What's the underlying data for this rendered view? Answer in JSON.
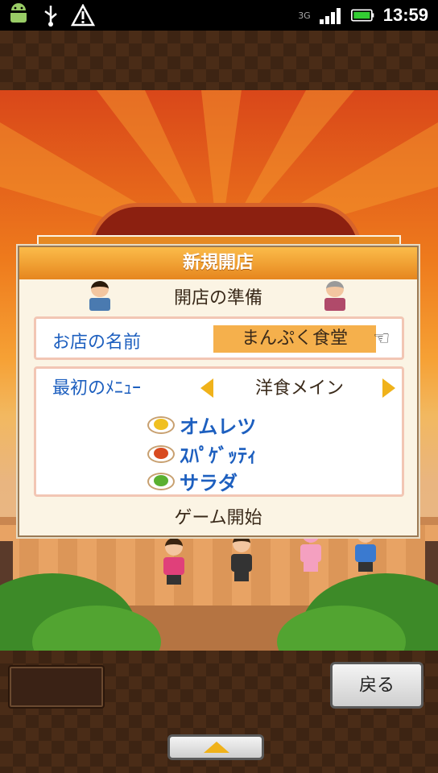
{
  "status_bar": {
    "network": "3G",
    "time": "13:59"
  },
  "dialog": {
    "title": "新規開店",
    "subtitle": "開店の準備",
    "shop_name_label": "お店の名前",
    "shop_name_value": "まんぷく食堂",
    "menu_label": "最初のﾒﾆｭｰ",
    "menu_value": "洋食メイン",
    "dishes": [
      "オムレツ",
      "ｽﾊﾟｹﾞｯﾃｨ",
      "サラダ"
    ],
    "start_label": "ゲーム開始"
  },
  "controls": {
    "back_label": "戻る"
  },
  "colors": {
    "accent_orange": "#e6861e",
    "label_blue": "#1d5fbf",
    "arrow_yellow": "#f0b21a"
  }
}
